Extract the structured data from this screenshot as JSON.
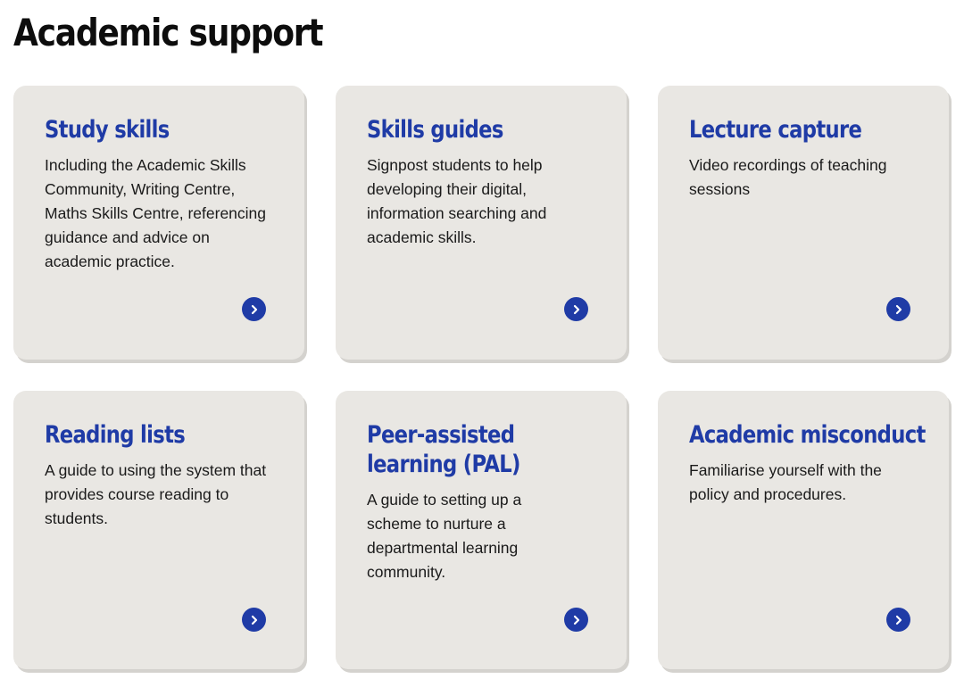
{
  "header": {
    "title": "Academic support"
  },
  "cards": [
    {
      "title": "Study skills",
      "description": "Including the Academic Skills Community, Writing Centre, Maths Skills Centre, referencing guidance and advice on academic practice."
    },
    {
      "title": "Skills guides",
      "description": "Signpost students to help developing their digital, information searching and academic skills."
    },
    {
      "title": "Lecture capture",
      "description": "Video recordings of teaching sessions"
    },
    {
      "title": "Reading lists",
      "description": "A guide to using the system that provides course reading to students."
    },
    {
      "title": "Peer-assisted learning (PAL)",
      "description": "A guide to setting up a scheme to nurture a departmental learning community."
    },
    {
      "title": "Academic misconduct",
      "description": "Familiarise yourself with the policy and procedures."
    }
  ],
  "icons": {
    "card_arrow": "chevron-right-circle-icon"
  },
  "colors": {
    "card_background": "#e9e7e3",
    "accent_blue": "#1f3ba6",
    "title_text": "#0d0d0d"
  }
}
